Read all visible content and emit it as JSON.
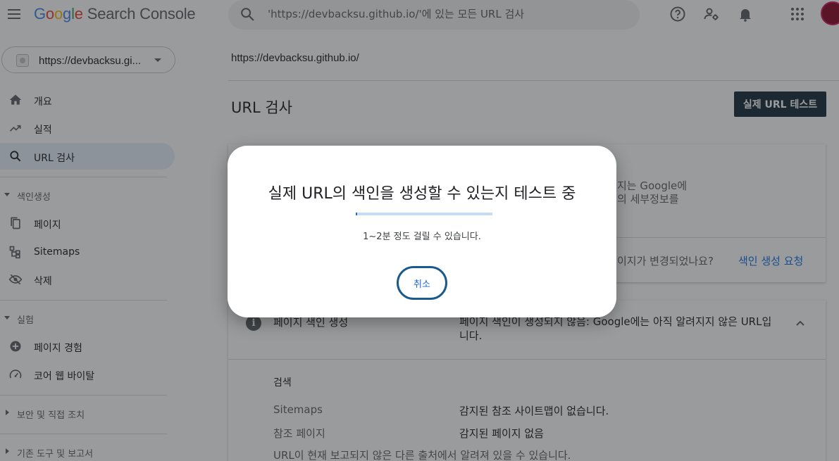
{
  "header": {
    "brand": {
      "g": "G",
      "o1": "o",
      "o2": "o",
      "g2": "g",
      "l": "l",
      "e": "e",
      "product": " Search Console"
    },
    "search_placeholder": "'https://devbacksu.github.io/'에 있는 모든 URL 검사",
    "icons": [
      "menu-icon",
      "help-icon",
      "manage-users-icon",
      "notifications-icon",
      "apps-icon",
      "account-avatar"
    ]
  },
  "sidebar": {
    "property_label": "https://devbacksu.gi...",
    "items": [
      {
        "label": "개요",
        "icon": "home-icon"
      },
      {
        "label": "실적",
        "icon": "trending-up-icon"
      },
      {
        "label": "URL 검사",
        "icon": "search-icon",
        "active": true
      }
    ],
    "section_index": {
      "label": "색인생성"
    },
    "index_items": [
      {
        "label": "페이지",
        "icon": "pages-icon"
      },
      {
        "label": "Sitemaps",
        "icon": "sitemap-icon"
      },
      {
        "label": "삭제",
        "icon": "removals-icon"
      }
    ],
    "section_experience": {
      "label": "실험"
    },
    "experience_items": [
      {
        "label": "페이지 경험",
        "icon": "page-experience-icon"
      },
      {
        "label": "코어 웹 바이탈",
        "icon": "speedometer-icon"
      }
    ],
    "section_security": {
      "label": "보안 및 직접 조치"
    },
    "section_legacy": {
      "label": "기존 도구 및 보고서"
    }
  },
  "main": {
    "breadcrumb": "https://devbacksu.github.io/",
    "title": "URL 검사",
    "live_test_button": "실제 URL 테스트",
    "card1": {
      "text_line1": "지는 Google에",
      "text_line2": "의 세부정보를",
      "question": "이지가 변경되었나요?",
      "request_indexing": "색인 생성 요청"
    },
    "card2": {
      "title": "페이지 색인 생성",
      "status": "페이지 색인이 생성되지 않음: Google에는 아직 알려지지 않은 URL입니다.",
      "crawl_heading": "검색",
      "rows": [
        {
          "label": "Sitemaps",
          "value": "감지된 참조 사이트맵이 없습니다."
        },
        {
          "label": "참조 페이지",
          "value": "감지된 페이지 없음"
        }
      ],
      "footnote": "URL이 현재 보고되지 않은 다른 출처에서 알려져 있을 수 있습니다."
    }
  },
  "dialog": {
    "title": "실제 URL의 색인을 생성할 수 있는지 테스트 중",
    "progress_fraction": 0.01,
    "subtitle": "1~2분 정도 걸릴 수 있습니다.",
    "cancel_label": "취소"
  },
  "colors": {
    "brand_blue": "#4285f4",
    "brand_red": "#ea4335",
    "brand_yellow": "#fbbc05",
    "brand_green": "#34a853",
    "primary_button": "#1a2f3f",
    "active_nav_bg": "#e8f0fe",
    "progress_track": "#c6dcf2",
    "progress_fill": "#1a73e8"
  }
}
